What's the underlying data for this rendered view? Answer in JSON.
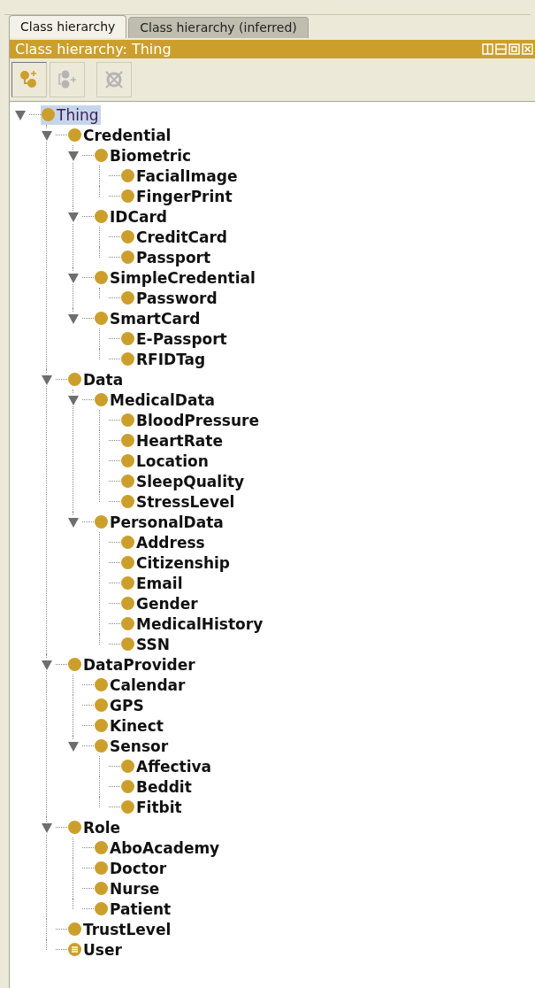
{
  "tabs": [
    {
      "label": "Class hierarchy",
      "selected": true
    },
    {
      "label": "Class hierarchy (inferred)",
      "selected": false
    }
  ],
  "view": {
    "title": "Class hierarchy: Thing"
  },
  "toolbar": [
    {
      "kind": "add-subclass",
      "disabled": false
    },
    {
      "kind": "add-sibling",
      "disabled": true
    },
    {
      "kind": "delete",
      "disabled": true
    }
  ],
  "tree": [
    {
      "label": "Thing",
      "kind": "root",
      "selected": true,
      "expanded": true,
      "children": [
        {
          "label": "Credential",
          "kind": "class",
          "selected": false,
          "expanded": true,
          "children": [
            {
              "label": "Biometric",
              "kind": "class",
              "selected": false,
              "expanded": true,
              "children": [
                {
                  "label": "FacialImage",
                  "kind": "class",
                  "selected": false
                },
                {
                  "label": "FingerPrint",
                  "kind": "class",
                  "selected": false
                }
              ]
            },
            {
              "label": "IDCard",
              "kind": "class",
              "selected": false,
              "expanded": true,
              "children": [
                {
                  "label": "CreditCard",
                  "kind": "class",
                  "selected": false
                },
                {
                  "label": "Passport",
                  "kind": "class",
                  "selected": false
                }
              ]
            },
            {
              "label": "SimpleCredential",
              "kind": "class",
              "selected": false,
              "expanded": true,
              "children": [
                {
                  "label": "Password",
                  "kind": "class",
                  "selected": false
                }
              ]
            },
            {
              "label": "SmartCard",
              "kind": "class",
              "selected": false,
              "expanded": true,
              "children": [
                {
                  "label": "E-Passport",
                  "kind": "class",
                  "selected": false
                },
                {
                  "label": "RFIDTag",
                  "kind": "class",
                  "selected": false
                }
              ]
            }
          ]
        },
        {
          "label": "Data",
          "kind": "class",
          "selected": false,
          "expanded": true,
          "children": [
            {
              "label": "MedicalData",
              "kind": "class",
              "selected": false,
              "expanded": true,
              "children": [
                {
                  "label": "BloodPressure",
                  "kind": "class",
                  "selected": false
                },
                {
                  "label": "HeartRate",
                  "kind": "class",
                  "selected": false
                },
                {
                  "label": "Location",
                  "kind": "class",
                  "selected": false
                },
                {
                  "label": "SleepQuality",
                  "kind": "class",
                  "selected": false
                },
                {
                  "label": "StressLevel",
                  "kind": "class",
                  "selected": false
                }
              ]
            },
            {
              "label": "PersonalData",
              "kind": "class",
              "selected": false,
              "expanded": true,
              "children": [
                {
                  "label": "Address",
                  "kind": "class",
                  "selected": false
                },
                {
                  "label": "Citizenship",
                  "kind": "class",
                  "selected": false
                },
                {
                  "label": "Email",
                  "kind": "class",
                  "selected": false
                },
                {
                  "label": "Gender",
                  "kind": "class",
                  "selected": false
                },
                {
                  "label": "MedicalHistory",
                  "kind": "class",
                  "selected": false
                },
                {
                  "label": "SSN",
                  "kind": "class",
                  "selected": false
                }
              ]
            }
          ]
        },
        {
          "label": "DataProvider",
          "kind": "class",
          "selected": false,
          "expanded": true,
          "children": [
            {
              "label": "Calendar",
              "kind": "class",
              "selected": false
            },
            {
              "label": "GPS",
              "kind": "class",
              "selected": false
            },
            {
              "label": "Kinect",
              "kind": "class",
              "selected": false
            },
            {
              "label": "Sensor",
              "kind": "class",
              "selected": false,
              "expanded": true,
              "children": [
                {
                  "label": "Affectiva",
                  "kind": "class",
                  "selected": false
                },
                {
                  "label": "Beddit",
                  "kind": "class",
                  "selected": false
                },
                {
                  "label": "Fitbit",
                  "kind": "class",
                  "selected": false
                }
              ]
            }
          ]
        },
        {
          "label": "Role",
          "kind": "class",
          "selected": false,
          "expanded": true,
          "children": [
            {
              "label": "AboAcademy",
              "kind": "class",
              "selected": false
            },
            {
              "label": "Doctor",
              "kind": "class",
              "selected": false
            },
            {
              "label": "Nurse",
              "kind": "class",
              "selected": false
            },
            {
              "label": "Patient",
              "kind": "class",
              "selected": false
            }
          ]
        },
        {
          "label": "TrustLevel",
          "kind": "class",
          "selected": false
        },
        {
          "label": "User",
          "kind": "defined",
          "selected": false
        }
      ]
    }
  ]
}
